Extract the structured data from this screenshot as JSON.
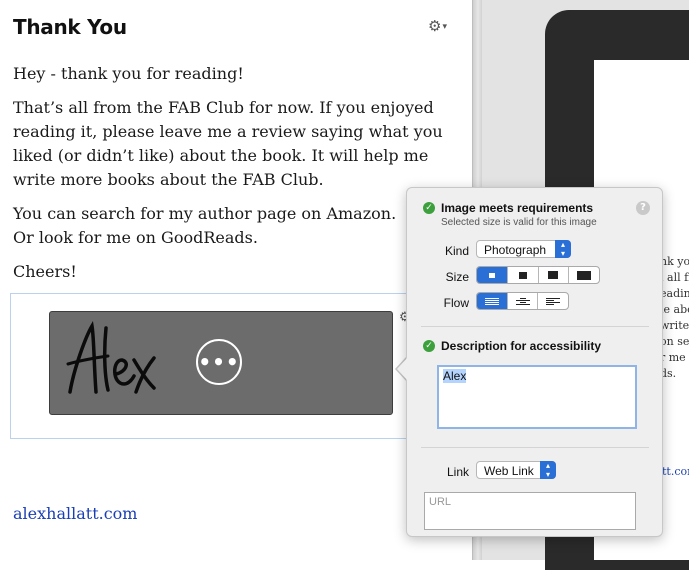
{
  "document": {
    "heading": "Thank You",
    "paragraphs": [
      "Hey - thank you for reading!",
      "That’s all from the FAB Club for now. If you enjoyed reading it, please leave me a review saying what you liked (or didn’t like) about the book. It will help me write more books about the FAB Club.",
      "You can search for my author page on Amazon.",
      "Or look for me on GoodReads.",
      "Cheers!"
    ],
    "image_text": "Alex",
    "link": "alexhallatt.com"
  },
  "preview": {
    "fragments": [
      "nk you",
      "l all fr",
      "eading",
      "le abou",
      "write m",
      "on sea",
      "r me o",
      "ds."
    ],
    "link_fragment": "tt.com"
  },
  "popover": {
    "status_title": "Image meets requirements",
    "status_subtitle": "Selected size is valid for this image",
    "help_glyph": "?",
    "kind_label": "Kind",
    "kind_value": "Photograph",
    "size_label": "Size",
    "size_options": [
      "small",
      "medium",
      "large",
      "full-width"
    ],
    "size_selected": "small",
    "flow_label": "Flow",
    "flow_options": [
      "wrap-text",
      "center",
      "text-right"
    ],
    "flow_selected": "wrap-text",
    "access_title": "Description for accessibility",
    "access_value": "Alex",
    "link_label": "Link",
    "link_value": "Web Link",
    "url_placeholder": "URL"
  },
  "icons": {
    "gear": "gear-icon",
    "more": "more-options-icon",
    "check": "checkmark-icon",
    "help": "help-icon"
  },
  "colors": {
    "accent": "#2a6fd6",
    "success": "#3ca03c",
    "link": "#1a3fb4",
    "selection": "#b9d3ee",
    "image_bg": "#6c6c6c"
  }
}
